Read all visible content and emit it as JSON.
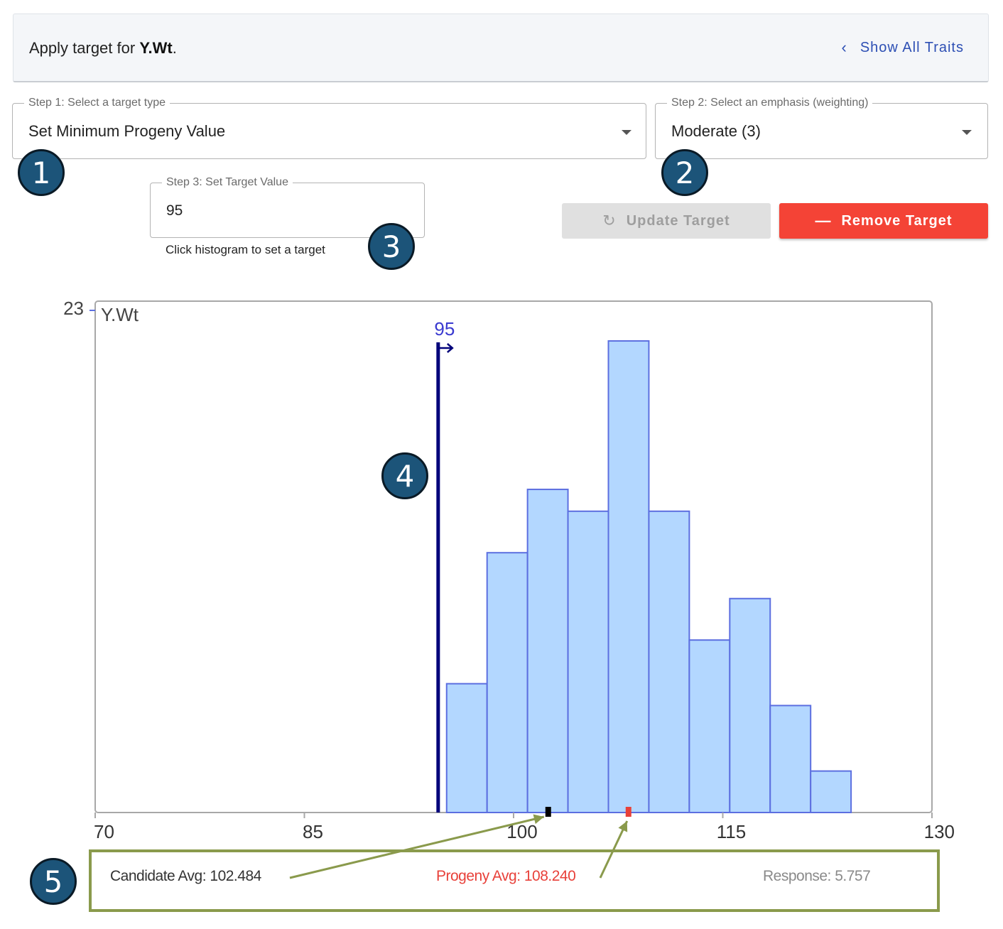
{
  "header": {
    "prefix": "Apply target for ",
    "trait": "Y.Wt",
    "suffix": ".",
    "show_all_label": "Show All Traits",
    "show_all_icon": "chevron-left-icon"
  },
  "step1": {
    "legend": "Step 1: Select a target type",
    "value": "Set Minimum Progeny Value"
  },
  "step2": {
    "legend": "Step 2: Select an emphasis (weighting)",
    "value": "Moderate (3)"
  },
  "step3": {
    "legend": "Step 3: Set Target Value",
    "value": "95",
    "helper": "Click histogram to set a target"
  },
  "buttons": {
    "update_label": "Update Target",
    "update_icon": "refresh-icon",
    "remove_label": "Remove Target",
    "remove_icon": "minus-icon"
  },
  "badges": [
    "1",
    "2",
    "3",
    "4",
    "5"
  ],
  "chart_data": {
    "type": "bar",
    "title": "Y.Wt",
    "x_ticks": [
      70,
      85,
      100,
      115,
      130
    ],
    "x_range": [
      70,
      130
    ],
    "y_max_label": "23",
    "y_range": [
      0,
      23
    ],
    "bins": [
      {
        "start": 95.2,
        "end": 98.1,
        "count": 5.9
      },
      {
        "start": 98.1,
        "end": 101.0,
        "count": 11.9
      },
      {
        "start": 101.0,
        "end": 103.9,
        "count": 14.8
      },
      {
        "start": 103.9,
        "end": 106.8,
        "count": 13.8
      },
      {
        "start": 106.8,
        "end": 109.7,
        "count": 21.6
      },
      {
        "start": 109.7,
        "end": 112.6,
        "count": 13.8
      },
      {
        "start": 112.6,
        "end": 115.5,
        "count": 7.9
      },
      {
        "start": 115.5,
        "end": 118.4,
        "count": 9.8
      },
      {
        "start": 118.4,
        "end": 121.3,
        "count": 4.9
      },
      {
        "start": 121.3,
        "end": 124.2,
        "count": 1.9
      }
    ],
    "target": {
      "value": 95,
      "label": "95"
    },
    "candidate_avg": 102.484,
    "progeny_avg": 108.24,
    "colors": {
      "bar_fill": "#b3d7ff",
      "bar_stroke": "#5c6fe0",
      "target": "#00007a",
      "candidate": "#000000",
      "progeny": "#e8413a",
      "annotation": "#8a9a4c"
    }
  },
  "stats": {
    "candidate": "Candidate Avg: 102.484",
    "progeny": "Progeny Avg: 108.240",
    "response": "Response: 5.757"
  }
}
